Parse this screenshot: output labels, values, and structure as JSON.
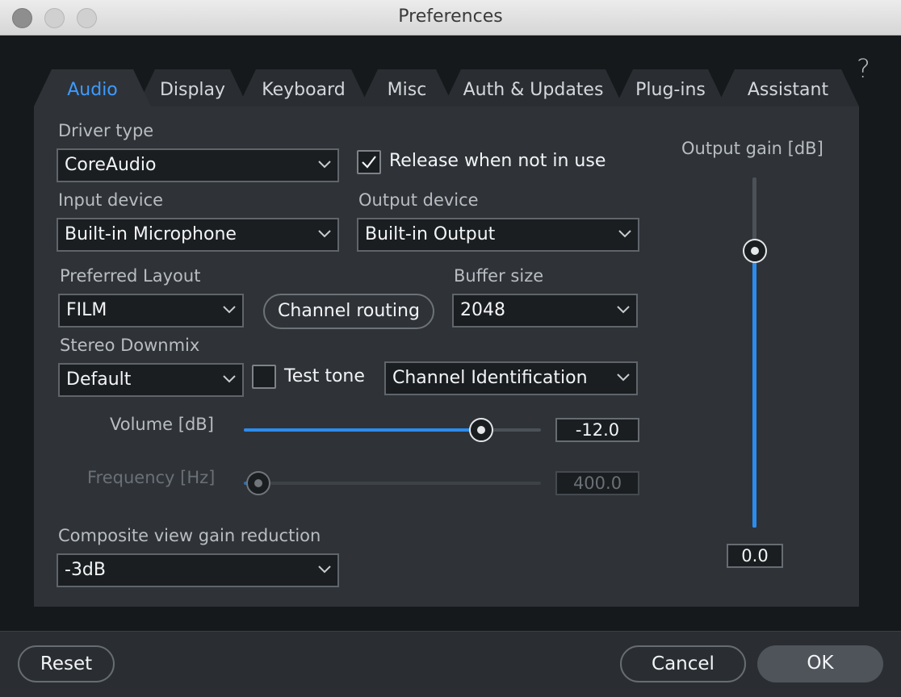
{
  "window": {
    "title": "Preferences"
  },
  "help_label": "?",
  "tabs": [
    {
      "label": "Audio",
      "active": true
    },
    {
      "label": "Display",
      "active": false
    },
    {
      "label": "Keyboard",
      "active": false
    },
    {
      "label": "Misc",
      "active": false
    },
    {
      "label": "Auth & Updates",
      "active": false
    },
    {
      "label": "Plug-ins",
      "active": false
    },
    {
      "label": "Assistant",
      "active": false
    }
  ],
  "audio": {
    "driver_type": {
      "label": "Driver type",
      "value": "CoreAudio"
    },
    "release_when_not_in_use": {
      "label": "Release when not in use",
      "checked": true
    },
    "input_device": {
      "label": "Input device",
      "value": "Built-in Microphone"
    },
    "output_device": {
      "label": "Output device",
      "value": "Built-in Output"
    },
    "preferred_layout": {
      "label": "Preferred Layout",
      "value": "FILM"
    },
    "channel_routing_label": "Channel routing",
    "buffer_size": {
      "label": "Buffer size",
      "value": "2048"
    },
    "stereo_downmix": {
      "label": "Stereo Downmix",
      "value": "Default"
    },
    "test_tone": {
      "label": "Test tone",
      "checked": false
    },
    "test_tone_type": {
      "value": "Channel Identification"
    },
    "volume": {
      "label": "Volume [dB]",
      "value": "-12.0",
      "fraction": 0.8
    },
    "frequency": {
      "label": "Frequency [Hz]",
      "value": "400.0",
      "fraction": 0.05,
      "enabled": false
    },
    "composite_view_gain_reduction": {
      "label": "Composite view gain reduction",
      "value": "-3dB"
    },
    "output_gain": {
      "label": "Output gain [dB]",
      "value": "0.0",
      "fraction": 0.79
    }
  },
  "footer": {
    "reset_label": "Reset",
    "cancel_label": "Cancel",
    "ok_label": "OK"
  },
  "colors": {
    "accent": "#2b8cf0",
    "active_tab_text": "#3d9bff",
    "panel": "#2f3338",
    "background": "#16191b"
  }
}
